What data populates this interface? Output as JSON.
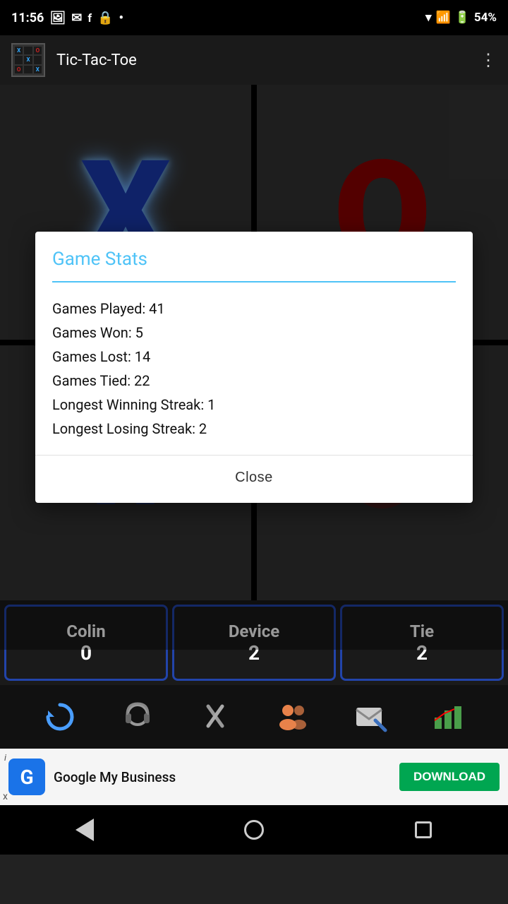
{
  "statusBar": {
    "time": "11:56",
    "battery": "54%"
  },
  "appBar": {
    "title": "Tic-Tac-Toe"
  },
  "dialog": {
    "title": "Game Stats",
    "stats": [
      "Games Played: 41",
      "Games Won: 5",
      "Games Lost: 14",
      "Games Tied: 22",
      "Longest Winning Streak: 1",
      "Longest Losing Streak: 2"
    ],
    "closeLabel": "Close"
  },
  "scores": [
    {
      "name": "Colin",
      "value": "0"
    },
    {
      "name": "Device",
      "value": "2"
    },
    {
      "name": "Tie",
      "value": "2"
    }
  ],
  "adBanner": {
    "appName": "Google My Business",
    "downloadLabel": "DOWNLOAD",
    "info": "i",
    "close": "x"
  },
  "navBar": {
    "back": "◀",
    "home": "●",
    "recents": "■"
  }
}
